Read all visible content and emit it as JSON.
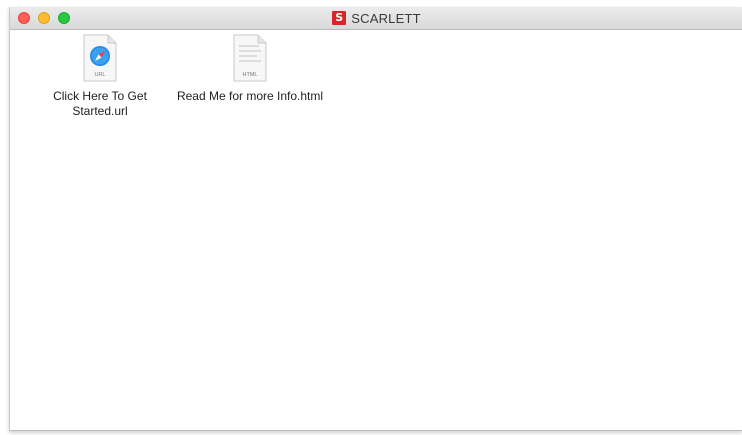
{
  "window": {
    "title": "SCARLETT",
    "title_icon_letter": "S",
    "title_icon_color": "#d6262b"
  },
  "traffic_lights": {
    "close_color": "#fe5f57",
    "minimize_color": "#febc2e",
    "zoom_color": "#28c840"
  },
  "files": [
    {
      "name": "Click Here To Get Started.url",
      "line1": "Click Here To Get",
      "line2": "Started.url",
      "icon": "safari-url-file-icon",
      "badge": "URL"
    },
    {
      "name": "Read Me for more Info.html",
      "line1": "Read Me for more Info.html",
      "icon": "html-file-icon",
      "badge": "HTML"
    }
  ]
}
